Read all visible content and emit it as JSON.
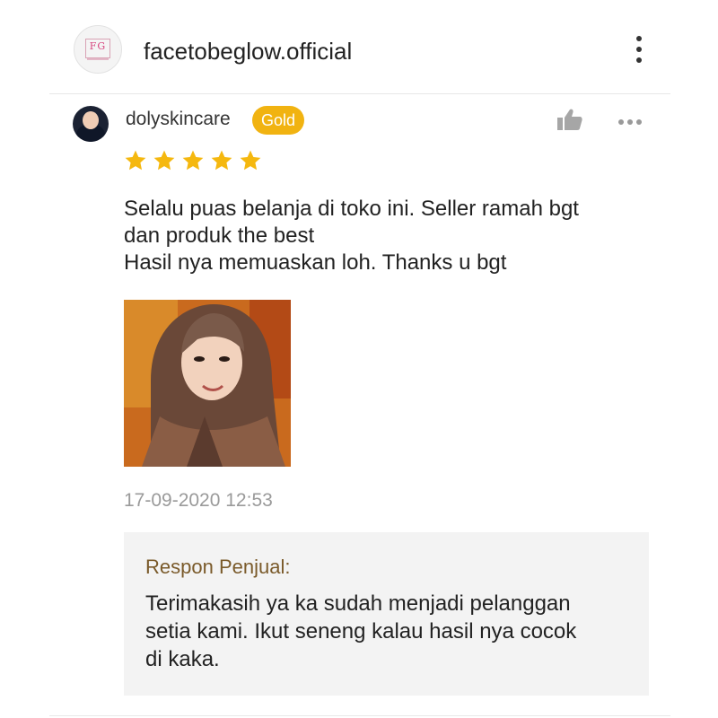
{
  "header": {
    "logo_text": "FG",
    "shop_name": "facetobeglow.official"
  },
  "review": {
    "username": "dolyskincare",
    "badge": "Gold",
    "rating": 5,
    "rating_max": 5,
    "comment_lines": [
      "Selalu puas belanja di toko ini. Seller ramah bgt",
      "dan produk the best",
      "Hasil nya memuaskan loh. Thanks u bgt"
    ],
    "timestamp": "17-09-2020 12:53"
  },
  "seller_response": {
    "title": "Respon Penjual:",
    "lines": [
      "Terimakasih ya ka sudah menjadi pelanggan",
      "setia kami. Ikut seneng kalau hasil nya cocok",
      "di kaka."
    ]
  },
  "icons": {
    "menu": "more-vert-icon",
    "like": "thumbs-up-icon",
    "more": "more-horiz-icon",
    "star": "star-icon"
  },
  "colors": {
    "badge": "#f1b311",
    "star": "#f5b80f",
    "seller_title": "#7a5a2a",
    "timestamp": "#9a9a9a",
    "seller_box_bg": "#f3f3f3"
  }
}
